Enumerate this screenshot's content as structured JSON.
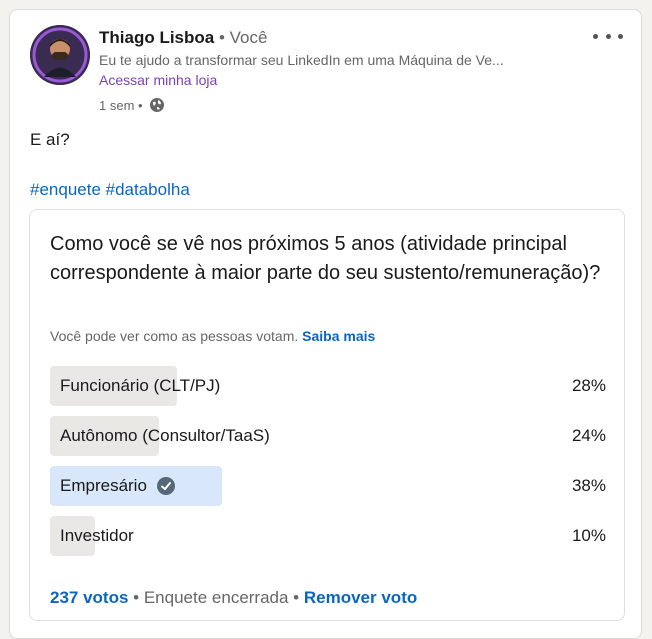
{
  "author": {
    "name": "Thiago Lisboa",
    "relation": "• Você",
    "headline": "Eu te ajudo a transformar seu LinkedIn em uma Máquina de Ve...",
    "store_link": "Acessar minha loja",
    "time": "1 sem •"
  },
  "post": {
    "text": "E aí?",
    "hashtags": [
      "#enquete",
      "#databolha"
    ]
  },
  "poll": {
    "question": "Como você se vê nos próximos 5 anos (atividade principal correspondente à maior parte do seu sustento/remuneração)?",
    "note": "Você pode ver como as pessoas votam.",
    "note_link": "Saiba mais",
    "options": [
      {
        "label": "Funcionário (CLT/PJ)",
        "percent_label": "28%",
        "percent": 28,
        "selected": false
      },
      {
        "label": "Autônomo (Consultor/TaaS)",
        "percent_label": "24%",
        "percent": 24,
        "selected": false
      },
      {
        "label": "Empresário",
        "percent_label": "38%",
        "percent": 38,
        "selected": true
      },
      {
        "label": "Investidor",
        "percent_label": "10%",
        "percent": 10,
        "selected": false
      }
    ],
    "votes": "237 votos",
    "status": "• Enquete encerrada •",
    "remove_vote": "Remover voto"
  },
  "colors": {
    "link": "#0a66c2",
    "store_link": "#7d3fb3",
    "bar": "#e9e8e5",
    "bar_selected": "#d9e7fb"
  },
  "icons": [
    "more-options-icon",
    "globe-icon",
    "check-circle-icon"
  ]
}
